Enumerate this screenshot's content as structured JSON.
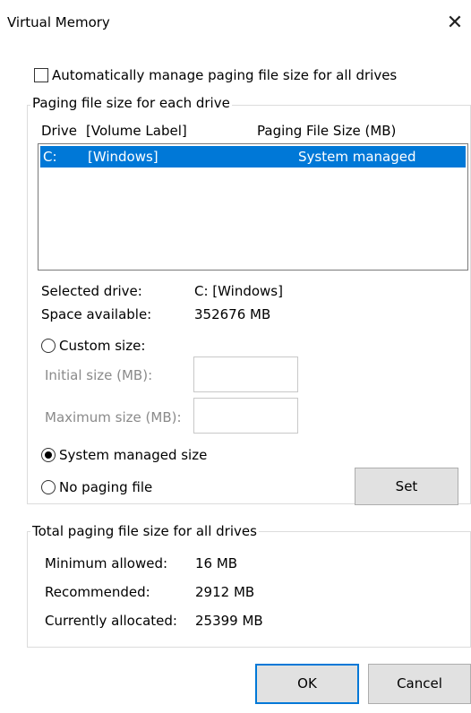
{
  "window": {
    "title": "Virtual Memory",
    "close_glyph": "✕"
  },
  "auto_manage": {
    "label": "Automatically manage paging file size for all drives",
    "checked": false
  },
  "drives_group": {
    "legend": "Paging file size for each drive",
    "col_drive": "Drive",
    "col_label": "[Volume Label]",
    "col_size": "Paging File Size (MB)",
    "rows": [
      {
        "drive": "C:",
        "label": "[Windows]",
        "size": "System managed",
        "selected": true
      }
    ],
    "selected_drive_label": "Selected drive:",
    "selected_drive_value": "C:  [Windows]",
    "space_label": "Space available:",
    "space_value": "352676 MB",
    "custom_label": "Custom size:",
    "initial_label": "Initial size (MB):",
    "initial_value": "",
    "maximum_label": "Maximum size (MB):",
    "maximum_value": "",
    "system_managed_label": "System managed size",
    "no_paging_label": "No paging file",
    "selected_option": "system_managed",
    "set_label": "Set"
  },
  "total_group": {
    "legend": "Total paging file size for all drives",
    "min_label": "Minimum allowed:",
    "min_value": "16 MB",
    "rec_label": "Recommended:",
    "rec_value": "2912 MB",
    "cur_label": "Currently allocated:",
    "cur_value": "25399 MB"
  },
  "footer": {
    "ok_label": "OK",
    "cancel_label": "Cancel"
  },
  "colors": {
    "selection": "#0078d7",
    "button_face": "#e1e1e1",
    "disabled_text": "#8a8a8a"
  }
}
